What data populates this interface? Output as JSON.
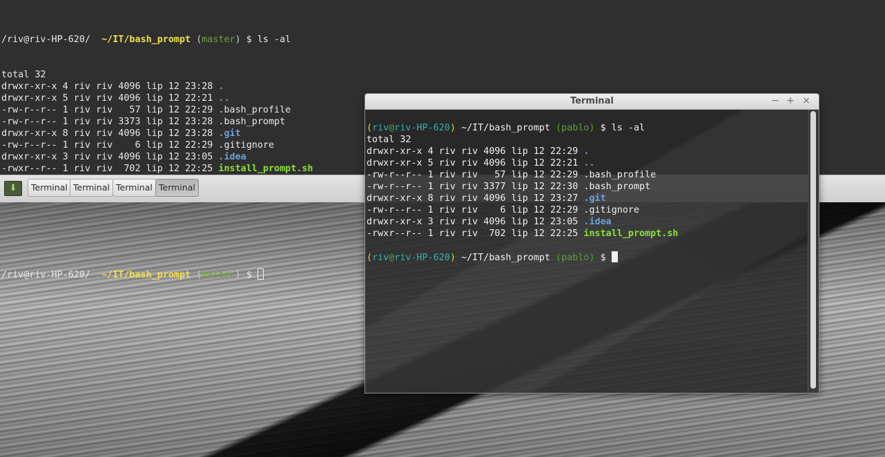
{
  "bg_terminal": {
    "prompt1": {
      "user_host": "/riv@riv-HP-620/",
      "path": "~/IT/bash_prompt",
      "branch": "master",
      "cmd": "$ ls -al"
    },
    "output": [
      {
        "meta": "total 32",
        "name": "",
        "kind": "plain"
      },
      {
        "meta": "drwxr-xr-x 4 riv riv 4096 lip 12 23:28 ",
        "name": ".",
        "kind": "dir"
      },
      {
        "meta": "drwxr-xr-x 5 riv riv 4096 lip 12 22:21 ",
        "name": "..",
        "kind": "dir"
      },
      {
        "meta": "-rw-r--r-- 1 riv riv   57 lip 12 22:29 ",
        "name": ".bash_profile",
        "kind": "plain"
      },
      {
        "meta": "-rw-r--r-- 1 riv riv 3373 lip 12 23:28 ",
        "name": ".bash_prompt",
        "kind": "plain"
      },
      {
        "meta": "drwxr-xr-x 8 riv riv 4096 lip 12 23:28 ",
        "name": ".git",
        "kind": "dir"
      },
      {
        "meta": "-rw-r--r-- 1 riv riv    6 lip 12 22:29 ",
        "name": ".gitignore",
        "kind": "plain"
      },
      {
        "meta": "drwxr-xr-x 3 riv riv 4096 lip 12 23:05 ",
        "name": ".idea",
        "kind": "dir"
      },
      {
        "meta": "-rwxr--r-- 1 riv riv  702 lip 12 22:25 ",
        "name": "install_prompt.sh",
        "kind": "exec"
      }
    ],
    "prompt2": {
      "user_host": "/riv@riv-HP-620/",
      "path": "~/IT/bash_prompt",
      "branch": "master",
      "cmd": "$"
    }
  },
  "taskbar": {
    "menu_icon": "mint-menu-icon",
    "tasks": [
      {
        "label": "Terminal",
        "active": false
      },
      {
        "label": "Terminal",
        "active": false
      },
      {
        "label": "Terminal",
        "active": false
      },
      {
        "label": "Terminal",
        "active": true
      }
    ]
  },
  "window": {
    "title": "Terminal",
    "buttons": {
      "minimize": "−",
      "maximize": "+",
      "close": "×"
    },
    "prompt1": {
      "user": "riv",
      "at": "@",
      "host": "riv-HP-620",
      "path": "~/IT/bash_prompt",
      "branch": "pablo",
      "cmd": "$ ls -al"
    },
    "output": [
      {
        "meta": "total 32",
        "name": "",
        "kind": "plain"
      },
      {
        "meta": "drwxr-xr-x 4 riv riv 4096 lip 12 22:29 ",
        "name": ".",
        "kind": "dir"
      },
      {
        "meta": "drwxr-xr-x 5 riv riv 4096 lip 12 22:21 ",
        "name": "..",
        "kind": "dir"
      },
      {
        "meta": "-rw-r--r-- 1 riv riv   57 lip 12 22:29 ",
        "name": ".bash_profile",
        "kind": "plain"
      },
      {
        "meta": "-rw-r--r-- 1 riv riv 3377 lip 12 22:30 ",
        "name": ".bash_prompt",
        "kind": "plain"
      },
      {
        "meta": "drwxr-xr-x 8 riv riv 4096 lip 12 23:27 ",
        "name": ".git",
        "kind": "dir"
      },
      {
        "meta": "-rw-r--r-- 1 riv riv    6 lip 12 22:29 ",
        "name": ".gitignore",
        "kind": "plain"
      },
      {
        "meta": "drwxr-xr-x 3 riv riv 4096 lip 12 23:05 ",
        "name": ".idea",
        "kind": "dir"
      },
      {
        "meta": "-rwxr--r-- 1 riv riv  702 lip 12 22:25 ",
        "name": "install_prompt.sh",
        "kind": "exec"
      }
    ],
    "prompt2": {
      "user": "riv",
      "at": "@",
      "host": "riv-HP-620",
      "path": "~/IT/bash_prompt",
      "branch": "pablo",
      "cmd": "$"
    }
  },
  "colors": {
    "terminal_bg": "#2f2f2f",
    "path_yellow": "#f2e04a",
    "branch_green": "#6fa43a",
    "dir_blue": "#6f9fd8",
    "exec_green": "#8ae234",
    "host_cyan": "#34b0b0"
  }
}
